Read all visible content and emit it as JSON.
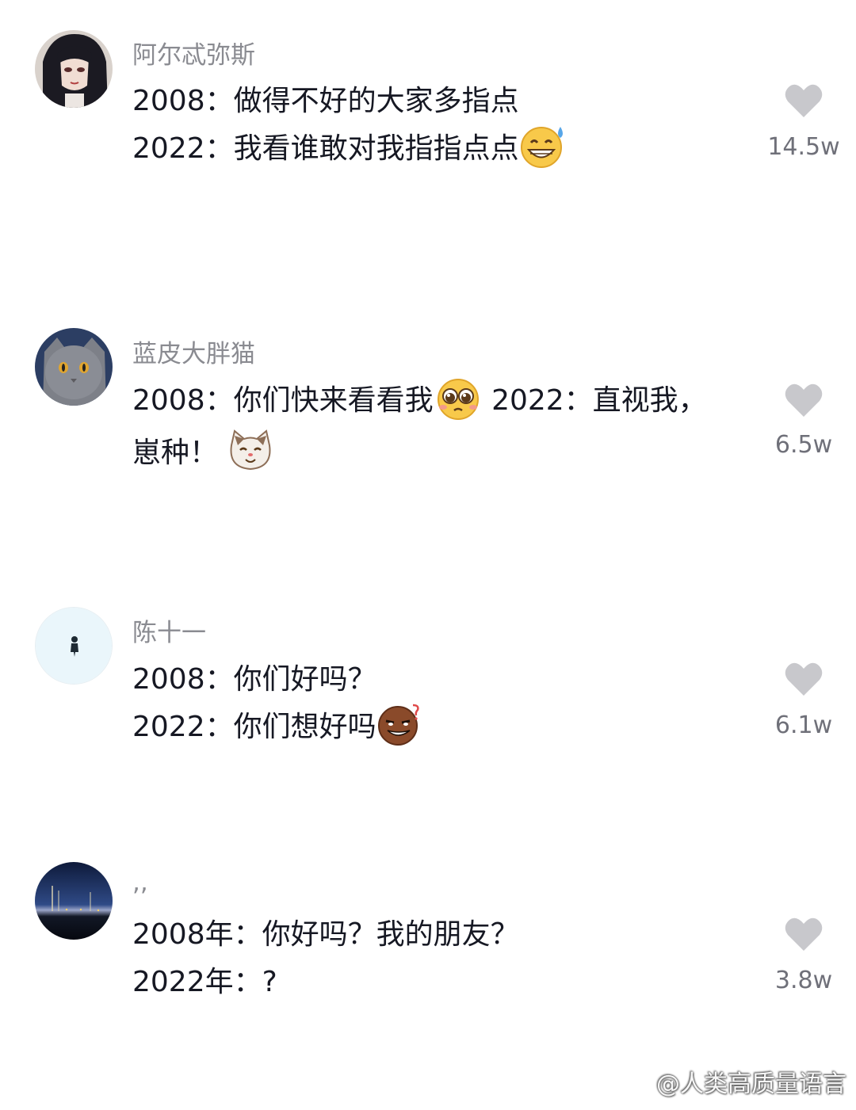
{
  "comments": [
    {
      "username": "阿尔忒弥斯",
      "line1": "2008：做得不好的大家多指点",
      "line2": "2022：我看谁敢对我指指点点",
      "likes": "14.5w",
      "emoji": "grin-sweat-emoji",
      "avatar": "anime-girl-avatar"
    },
    {
      "username": "蓝皮大胖猫",
      "line1_a": "2008：你们快来看看我",
      "line1_b": " 2022：直视我，",
      "line2": "崽种！",
      "likes": "6.5w",
      "emoji1": "pleading-emoji",
      "emoji2": "cat-face-emoji",
      "avatar": "gray-cat-avatar"
    },
    {
      "username": "陈十一",
      "line1": "2008：你们好吗？",
      "line2": "2022：你们想好吗",
      "likes": "6.1w",
      "emoji": "smirk-coffee-emoji",
      "avatar": "tiny-figure-avatar"
    },
    {
      "username": ",,",
      "line1": "2008年：你好吗？我的朋友？",
      "line2": "2022年：?",
      "likes": "3.8w",
      "avatar": "night-harbor-avatar"
    }
  ],
  "watermark": "@人类高质量语言",
  "colors": {
    "username": "#8a8b91",
    "text": "#161823",
    "like_count": "#6f7079",
    "heart": "#c8c8cc"
  },
  "icons": [
    "heart-icon",
    "weibo-icon"
  ]
}
